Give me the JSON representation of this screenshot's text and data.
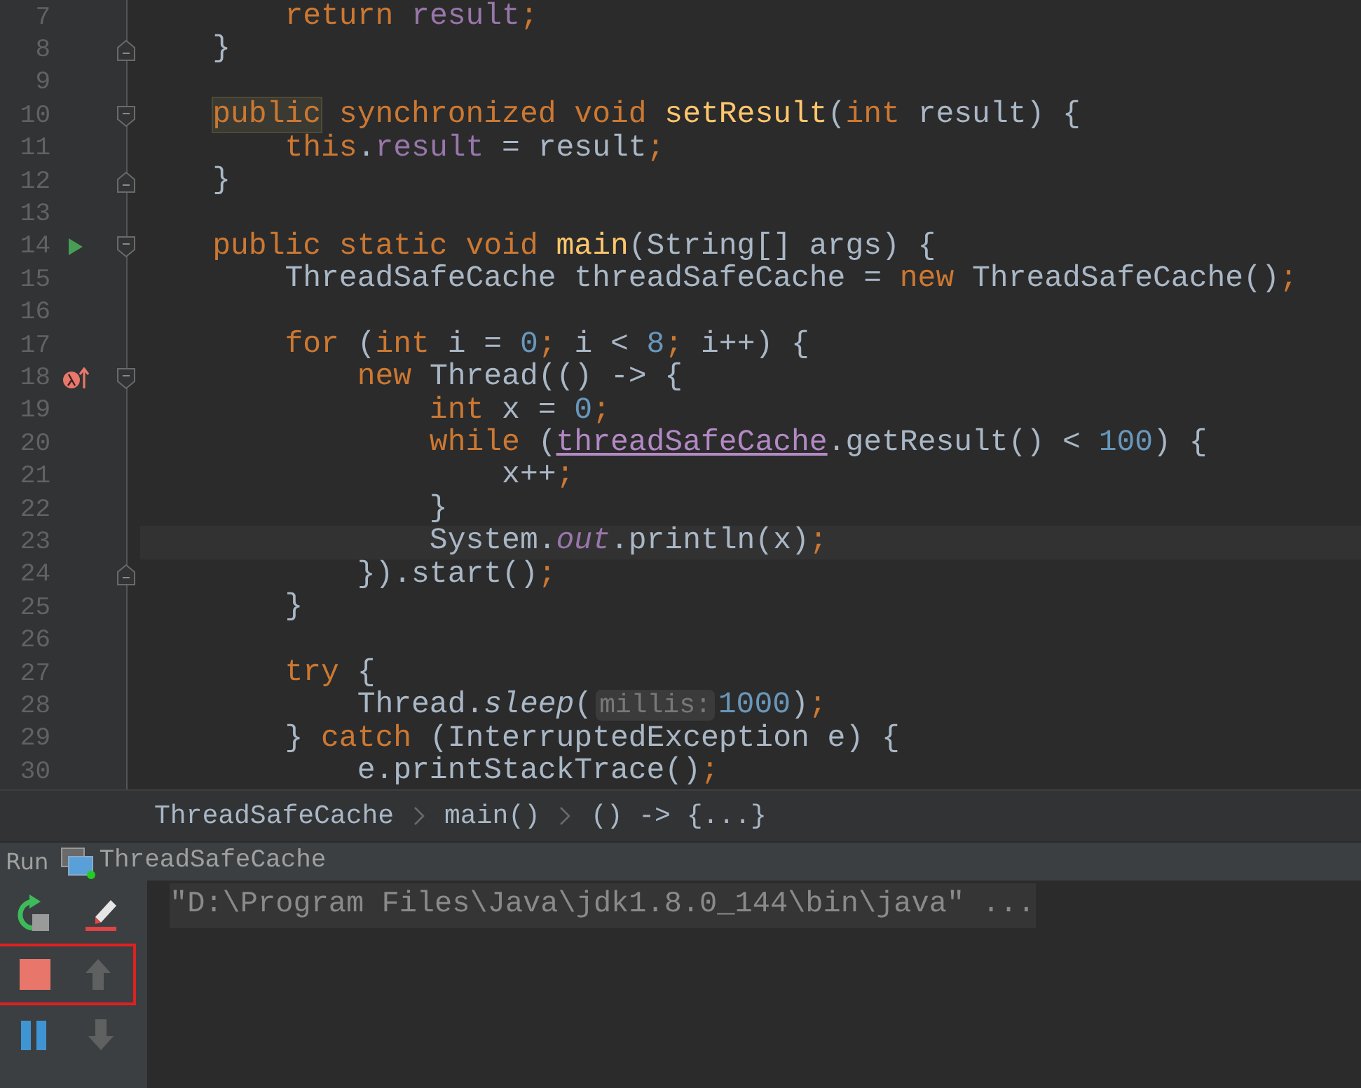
{
  "editor": {
    "lines": [
      {
        "number": "7",
        "tokens": [
          {
            "t": "        return",
            "kind": "kw"
          },
          {
            "t": " result",
            "kind": "field"
          },
          {
            "t": ";",
            "kind": "kw"
          }
        ]
      },
      {
        "number": "8",
        "gutter": [
          {
            "kind": "fold_end"
          }
        ],
        "tokens": [
          {
            "t": "    }",
            "kind": "plain"
          }
        ]
      },
      {
        "number": "9"
      },
      {
        "number": "10",
        "gutter": [
          {
            "kind": "fold_start"
          }
        ],
        "tokens": [
          {
            "t": "    public",
            "kind": "kw_hl"
          },
          {
            "t": " synchronized void",
            "kind": "kw"
          },
          {
            "t": " setResult",
            "kind": "fn"
          },
          {
            "t": "(",
            "kind": "plain"
          },
          {
            "t": "int",
            "kind": "kw"
          },
          {
            "t": " result) {",
            "kind": "plain"
          }
        ]
      },
      {
        "number": "11",
        "tokens": [
          {
            "t": "        this",
            "kind": "kw"
          },
          {
            "t": ".",
            "kind": "plain"
          },
          {
            "t": "result",
            "kind": "field"
          },
          {
            "t": " = result",
            "kind": "plain"
          },
          {
            "t": ";",
            "kind": "kw"
          }
        ]
      },
      {
        "number": "12",
        "gutter": [
          {
            "kind": "fold_end"
          }
        ],
        "tokens": [
          {
            "t": "    }",
            "kind": "plain"
          }
        ]
      },
      {
        "number": "13"
      },
      {
        "number": "14",
        "gutter": [
          {
            "kind": "run"
          },
          {
            "kind": "fold_start"
          }
        ],
        "tokens": [
          {
            "t": "    public static void",
            "kind": "kw"
          },
          {
            "t": " main",
            "kind": "fn"
          },
          {
            "t": "(String[] args) {",
            "kind": "plain"
          }
        ]
      },
      {
        "number": "15",
        "tokens": [
          {
            "t": "        ThreadSafeCache threadSafeCache =",
            "kind": "plain"
          },
          {
            "t": " new",
            "kind": "kw"
          },
          {
            "t": " ThreadSafeCache()",
            "kind": "plain"
          },
          {
            "t": ";",
            "kind": "kw"
          }
        ]
      },
      {
        "number": "16"
      },
      {
        "number": "17",
        "tokens": [
          {
            "t": "        for",
            "kind": "kw"
          },
          {
            "t": " (",
            "kind": "plain"
          },
          {
            "t": "int",
            "kind": "kw"
          },
          {
            "t": " i =",
            "kind": "plain"
          },
          {
            "t": " 0",
            "kind": "num"
          },
          {
            "t": ";",
            "kind": "kw"
          },
          {
            "t": " i <",
            "kind": "plain"
          },
          {
            "t": " 8",
            "kind": "num"
          },
          {
            "t": ";",
            "kind": "kw"
          },
          {
            "t": " i++) {",
            "kind": "plain"
          }
        ]
      },
      {
        "number": "18",
        "gutter": [
          {
            "kind": "lambda_breakpoint"
          },
          {
            "kind": "fold_start"
          }
        ],
        "tokens": [
          {
            "t": "            new",
            "kind": "kw"
          },
          {
            "t": " Thread(() -> {",
            "kind": "plain"
          }
        ]
      },
      {
        "number": "19",
        "tokens": [
          {
            "t": "                int",
            "kind": "kw"
          },
          {
            "t": " x =",
            "kind": "plain"
          },
          {
            "t": " 0",
            "kind": "num"
          },
          {
            "t": ";",
            "kind": "kw"
          }
        ]
      },
      {
        "number": "20",
        "tokens": [
          {
            "t": "                while",
            "kind": "kw"
          },
          {
            "t": " (",
            "kind": "plain"
          },
          {
            "t": "threadSafeCache",
            "kind": "captured"
          },
          {
            "t": ".getResult() <",
            "kind": "plain"
          },
          {
            "t": " 100",
            "kind": "num"
          },
          {
            "t": ") {",
            "kind": "plain"
          }
        ]
      },
      {
        "number": "21",
        "tokens": [
          {
            "t": "                    x++",
            "kind": "plain"
          },
          {
            "t": ";",
            "kind": "kw"
          }
        ]
      },
      {
        "number": "22",
        "tokens": [
          {
            "t": "                }",
            "kind": "plain"
          }
        ]
      },
      {
        "number": "23",
        "current": true,
        "tokens": [
          {
            "t": "                System.",
            "kind": "plain"
          },
          {
            "t": "out",
            "kind": "static_field"
          },
          {
            "t": ".println(x)",
            "kind": "plain"
          },
          {
            "t": ";",
            "kind": "kw"
          }
        ]
      },
      {
        "number": "24",
        "gutter": [
          {
            "kind": "fold_end"
          }
        ],
        "tokens": [
          {
            "t": "            }).start()",
            "kind": "plain"
          },
          {
            "t": ";",
            "kind": "kw"
          }
        ]
      },
      {
        "number": "25",
        "tokens": [
          {
            "t": "        }",
            "kind": "plain"
          }
        ]
      },
      {
        "number": "26"
      },
      {
        "number": "27",
        "tokens": [
          {
            "t": "        try",
            "kind": "kw"
          },
          {
            "t": " {",
            "kind": "plain"
          }
        ]
      },
      {
        "number": "28",
        "tokens": [
          {
            "t": "            Thread.",
            "kind": "plain"
          },
          {
            "t": "sleep",
            "kind": "static_call"
          },
          {
            "t": "(",
            "kind": "plain"
          },
          {
            "t": "millis:",
            "kind": "hint"
          },
          {
            "t": "1000",
            "kind": "num"
          },
          {
            "t": ")",
            "kind": "plain"
          },
          {
            "t": ";",
            "kind": "kw"
          }
        ]
      },
      {
        "number": "29",
        "tokens": [
          {
            "t": "        }",
            "kind": "plain"
          },
          {
            "t": " catch",
            "kind": "kw"
          },
          {
            "t": " (InterruptedException e) {",
            "kind": "plain"
          }
        ]
      },
      {
        "number": "30",
        "tokens": [
          {
            "t": "            e.printStackTrace()",
            "kind": "plain"
          },
          {
            "t": ";",
            "kind": "kw"
          }
        ]
      }
    ]
  },
  "breadcrumbs": [
    "ThreadSafeCache",
    "main()",
    "() -> {...}"
  ],
  "run_panel": {
    "label": "Run",
    "tab": "ThreadSafeCache",
    "toolbar_rows": [
      {
        "highlighted": false,
        "buttons": [
          {
            "kind": "rerun",
            "disabled": false
          },
          {
            "kind": "clear",
            "disabled": false
          }
        ]
      },
      {
        "highlighted": true,
        "buttons": [
          {
            "kind": "stop",
            "disabled": false
          },
          {
            "kind": "up",
            "disabled": true
          }
        ]
      },
      {
        "highlighted": false,
        "buttons": [
          {
            "kind": "pause",
            "disabled": false
          },
          {
            "kind": "down",
            "disabled": true
          }
        ]
      }
    ],
    "console_lines": [
      "\"D:\\Program Files\\Java\\jdk1.8.0_144\\bin\\java\" ..."
    ]
  }
}
